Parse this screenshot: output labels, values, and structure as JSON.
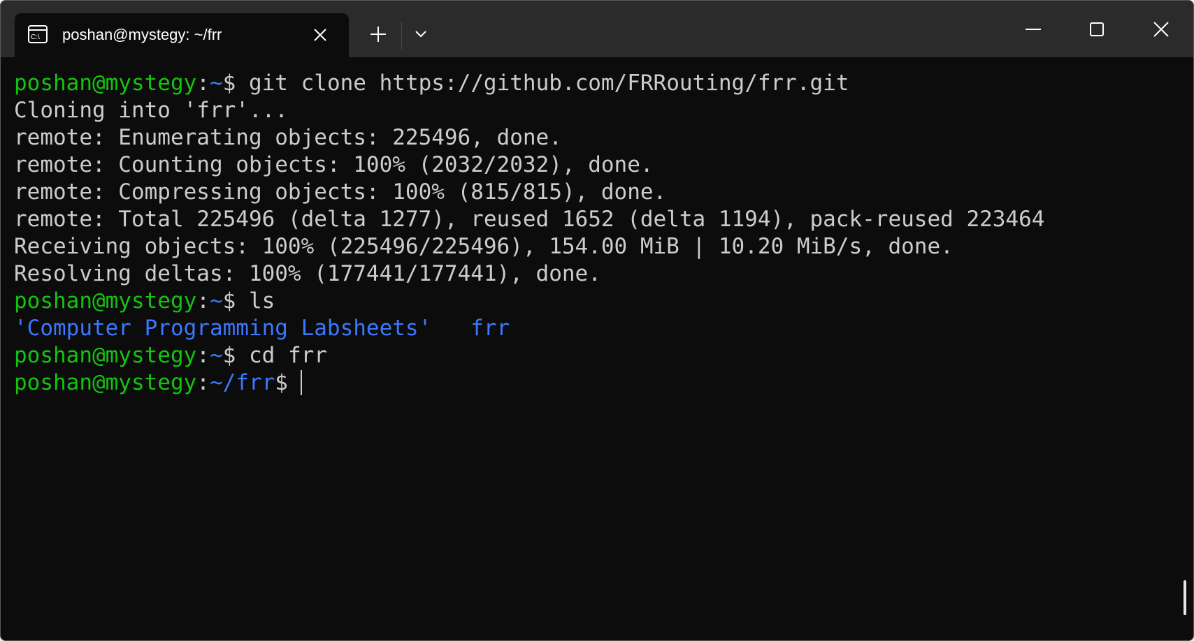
{
  "tab": {
    "title": "poshan@mystegy: ~/frr",
    "icon": "terminal-icon"
  },
  "colors": {
    "prompt_user": "#13c40e",
    "prompt_path": "#3b78ff",
    "text": "#cccccc",
    "directory": "#3b78ff",
    "background": "#0c0c0c",
    "titlebar": "#2b2b2b"
  },
  "terminal": {
    "lines": [
      {
        "user": "poshan@mystegy",
        "sep": ":",
        "path": "~",
        "dollar": "$",
        "command": " git clone https://github.com/FRRouting/frr.git"
      },
      {
        "text": "Cloning into 'frr'..."
      },
      {
        "text": "remote: Enumerating objects: 225496, done."
      },
      {
        "text": "remote: Counting objects: 100% (2032/2032), done."
      },
      {
        "text": "remote: Compressing objects: 100% (815/815), done."
      },
      {
        "text": "remote: Total 225496 (delta 1277), reused 1652 (delta 1194), pack-reused 223464"
      },
      {
        "text": "Receiving objects: 100% (225496/225496), 154.00 MiB | 10.20 MiB/s, done."
      },
      {
        "text": "Resolving deltas: 100% (177441/177441), done."
      },
      {
        "user": "poshan@mystegy",
        "sep": ":",
        "path": "~",
        "dollar": "$",
        "command": " ls"
      },
      {
        "entries": [
          "'Computer Programming Labsheets'",
          "frr"
        ]
      },
      {
        "user": "poshan@mystegy",
        "sep": ":",
        "path": "~",
        "dollar": "$",
        "command": " cd frr"
      },
      {
        "user": "poshan@mystegy",
        "sep": ":",
        "path": "~/frr",
        "dollar": "$",
        "command": ""
      }
    ]
  }
}
